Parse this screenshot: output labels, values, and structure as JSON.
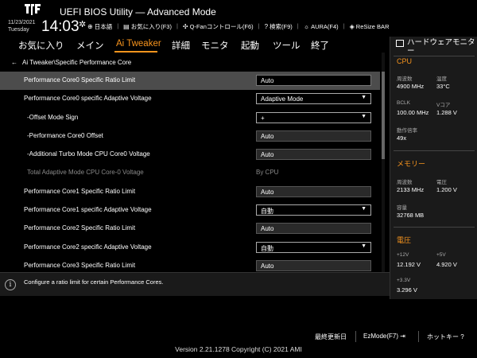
{
  "header": {
    "title": "UEFI BIOS Utility — Advanced Mode",
    "date": "11/23/2021",
    "day": "Tuesday",
    "time": "14:03",
    "toolbar": [
      {
        "icon": "globe-icon",
        "label": "日本語"
      },
      {
        "icon": "favorite-icon",
        "label": "お気に入り(F3)"
      },
      {
        "icon": "fan-icon",
        "label": "Q-Fanコントロール(F6)"
      },
      {
        "icon": "search-icon",
        "label": "検索(F9)"
      },
      {
        "icon": "aura-icon",
        "label": "AURA(F4)"
      },
      {
        "icon": "resize-bar-icon",
        "label": "ReSize BAR"
      }
    ]
  },
  "menu": {
    "items": [
      "お気に入り",
      "メイン",
      "Ai Tweaker",
      "詳細",
      "モニタ",
      "起動",
      "ツール",
      "終了"
    ],
    "active": "Ai Tweaker"
  },
  "breadcrumb": "Ai Tweaker\\Specific Performance Core",
  "rows": [
    {
      "label": "Performance Core0 Specific Ratio Limit",
      "value": "Auto",
      "kind": "field",
      "selected": true
    },
    {
      "label": "Performance Core0 specific Adaptive Voltage",
      "value": "Adaptive Mode",
      "kind": "dropdown"
    },
    {
      "label": "-Offset Mode Sign",
      "value": "+",
      "kind": "dropdown",
      "indent": true
    },
    {
      "label": "-Performance Core0 Offset",
      "value": "Auto",
      "kind": "field",
      "indent": true
    },
    {
      "label": "-Additional Turbo Mode CPU Core0 Voltage",
      "value": "Auto",
      "kind": "field",
      "indent": true
    },
    {
      "label": "Total Adaptive Mode CPU Core-0 Voltage",
      "value": "By CPU",
      "kind": "static",
      "indent": true,
      "muted": true
    },
    {
      "label": "Performance Core1 Specific Ratio Limit",
      "value": "Auto",
      "kind": "field"
    },
    {
      "label": "Performance Core1 specific Adaptive Voltage",
      "value": "自動",
      "kind": "dropdown"
    },
    {
      "label": "Performance Core2 Specific Ratio Limit",
      "value": "Auto",
      "kind": "field"
    },
    {
      "label": "Performance Core2 specific Adaptive Voltage",
      "value": "自動",
      "kind": "dropdown"
    },
    {
      "label": "Performance Core3 Specific Ratio Limit",
      "value": "Auto",
      "kind": "field"
    }
  ],
  "help": "Configure a ratio limit for certain Performance Cores.",
  "monitor": {
    "title": "ハードウェアモニター",
    "cpu": {
      "section": "CPU",
      "freq_label": "周波数",
      "freq": "4900 MHz",
      "temp_label": "温度",
      "temp": "33°C",
      "bclk_label": "BCLK",
      "bclk": "100.00 MHz",
      "vcore_label": "Vコア",
      "vcore": "1.288 V",
      "ratio_label": "動作倍率",
      "ratio": "49x"
    },
    "memory": {
      "section": "メモリー",
      "freq_label": "周波数",
      "freq": "2133 MHz",
      "volt_label": "電圧",
      "volt": "1.200 V",
      "cap_label": "容量",
      "cap": "32768 MB"
    },
    "voltage": {
      "section": "電圧",
      "v12_label": "+12V",
      "v12": "12.192 V",
      "v5_label": "+5V",
      "v5": "4.920 V",
      "v33_label": "+3.3V",
      "v33": "3.296 V"
    }
  },
  "footer": {
    "last_modified": "最終更新日",
    "ezmode": "EzMode(F7)",
    "hotkeys": "ホットキー",
    "copyright": "Version 2.21.1278 Copyright (C) 2021 AMI"
  },
  "colors": {
    "accent": "#f7941d",
    "selected_row": "#4c4c4c",
    "panel": "#1a1a1a"
  }
}
